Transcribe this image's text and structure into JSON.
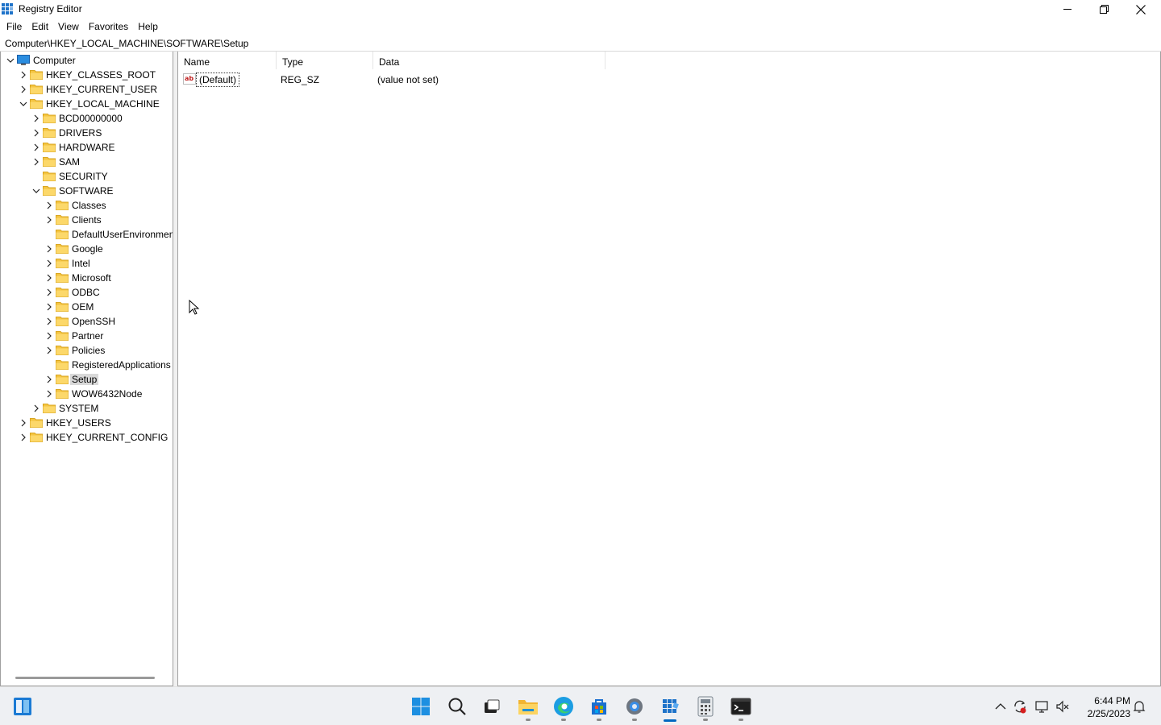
{
  "window": {
    "title": "Registry Editor",
    "icon": "regedit-icon"
  },
  "menu": [
    "File",
    "Edit",
    "View",
    "Favorites",
    "Help"
  ],
  "address": "Computer\\HKEY_LOCAL_MACHINE\\SOFTWARE\\Setup",
  "tree": {
    "root": "Computer",
    "hives": {
      "classes_root": "HKEY_CLASSES_ROOT",
      "current_user": "HKEY_CURRENT_USER",
      "local_machine": "HKEY_LOCAL_MACHINE",
      "users": "HKEY_USERS",
      "current_config": "HKEY_CURRENT_CONFIG"
    },
    "local_machine_children": [
      "BCD00000000",
      "DRIVERS",
      "HARDWARE",
      "SAM",
      "SECURITY",
      "SOFTWARE",
      "SYSTEM"
    ],
    "software_children": [
      "Classes",
      "Clients",
      "DefaultUserEnvironmen",
      "Google",
      "Intel",
      "Microsoft",
      "ODBC",
      "OEM",
      "OpenSSH",
      "Partner",
      "Policies",
      "RegisteredApplications",
      "Setup",
      "WOW6432Node"
    ],
    "selected": "Setup"
  },
  "list": {
    "columns": [
      "Name",
      "Type",
      "Data"
    ],
    "rows": [
      {
        "name": "(Default)",
        "type": "REG_SZ",
        "data": "(value not set)",
        "icon": "string-value-icon"
      }
    ]
  },
  "taskbar": {
    "apps": [
      "widgets",
      "start",
      "search",
      "task-view",
      "file-explorer",
      "edge",
      "store",
      "settings",
      "registry-editor",
      "calculator",
      "terminal"
    ],
    "active": "registry-editor",
    "time": "6:44 PM",
    "date": "2/25/2023"
  },
  "colors": {
    "accent": "#0067c0",
    "folder": "#f4c542",
    "selection": "#d9d9d9"
  }
}
